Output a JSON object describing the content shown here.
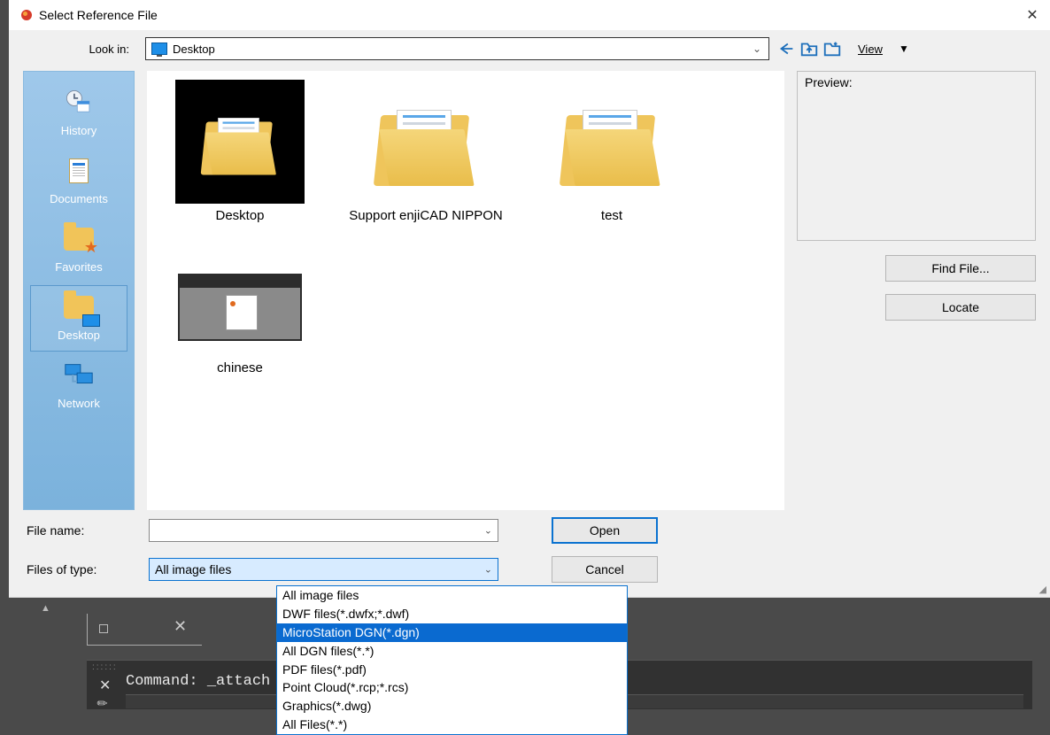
{
  "title": "Select Reference File",
  "lookin": {
    "label": "Look in:",
    "value": "Desktop"
  },
  "view_label": "View",
  "places": [
    {
      "label": "History"
    },
    {
      "label": "Documents"
    },
    {
      "label": "Favorites"
    },
    {
      "label": "Desktop"
    },
    {
      "label": "Network"
    }
  ],
  "files": [
    {
      "name": "Desktop"
    },
    {
      "name": "Support enjiCAD NIPPON"
    },
    {
      "name": "test"
    },
    {
      "name": "chinese"
    }
  ],
  "preview_label": "Preview:",
  "buttons": {
    "find_file": "Find File...",
    "locate": "Locate",
    "open": "Open",
    "cancel": "Cancel"
  },
  "file_name": {
    "label": "File name:",
    "value": ""
  },
  "file_type": {
    "label": "Files of type:",
    "value": "All image files",
    "options": [
      "All image files",
      "DWF files(*.dwfx;*.dwf)",
      "MicroStation DGN(*.dgn)",
      "All DGN files(*.*)",
      "PDF files(*.pdf)",
      "Point Cloud(*.rcp;*.rcs)",
      "Graphics(*.dwg)",
      "All Files(*.*)"
    ],
    "highlighted_index": 2
  },
  "command_line": "Command: _attach"
}
